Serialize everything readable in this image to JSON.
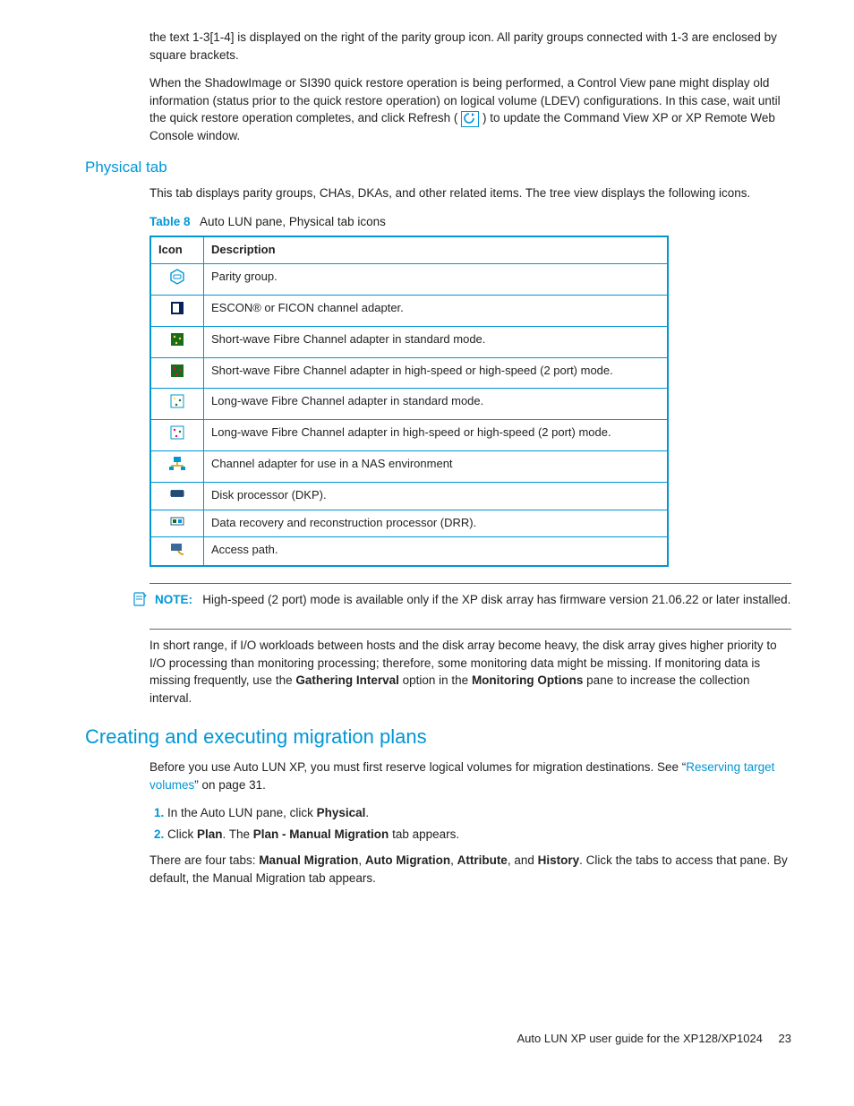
{
  "intro": {
    "p1": "the text 1-3[1-4] is displayed on the right of the parity group icon. All parity groups connected with 1-3 are enclosed by square brackets.",
    "p2a": "When the ShadowImage or SI390 quick restore operation is being performed, a Control View pane might display old information (status prior to the quick restore operation) on logical volume (LDEV) configurations. In this case, wait until the quick restore operation completes, and click Refresh (",
    "p2b": ") to update the Command View XP or XP Remote Web Console window."
  },
  "physical": {
    "heading": "Physical tab",
    "lead": "This tab displays parity groups, CHAs, DKAs, and other related items. The tree view displays the following icons.",
    "table_no": "Table 8",
    "table_title": "Auto LUN pane, Physical tab icons",
    "col_icon": "Icon",
    "col_desc": "Description",
    "rows": [
      "Parity group.",
      "ESCON® or FICON channel adapter.",
      "Short-wave Fibre Channel adapter in standard mode.",
      "Short-wave Fibre Channel adapter in high-speed or high-speed (2 port) mode.",
      "Long-wave Fibre Channel adapter in standard mode.",
      "Long-wave Fibre Channel adapter in high-speed or high-speed (2 port) mode.",
      "Channel adapter for use in a NAS environment",
      "Disk processor (DKP).",
      "Data recovery and reconstruction processor (DRR).",
      "Access path."
    ]
  },
  "note": {
    "label": "NOTE:",
    "text": "High-speed (2 port) mode is available only if the XP disk array has firmware version 21.06.22 or later installed."
  },
  "after_note": {
    "p1a": "In short range, if I/O workloads between hosts and the disk array become heavy, the disk array gives higher priority to I/O processing than monitoring processing; therefore, some monitoring data might be missing. If monitoring data is missing frequently, use the ",
    "b1": "Gathering Interval",
    "mid1": " option in the ",
    "b2": "Monitoring Options",
    "p1b": " pane to increase the collection interval."
  },
  "creating": {
    "heading": "Creating and executing migration plans",
    "lead_a": "Before you use Auto LUN XP, you must first reserve logical volumes for migration destinations. See “",
    "link": "Reserving target volumes",
    "lead_b": "” on page 31.",
    "step1a": "In the Auto LUN pane, click ",
    "step1b": "Physical",
    "step1c": ".",
    "step2a": "Click ",
    "step2b": "Plan",
    "step2c": ". The ",
    "step2d": "Plan - Manual Migration",
    "step2e": " tab appears.",
    "tail_a": "There are four tabs: ",
    "tail_b1": "Manual Migration",
    "tail_s1": ", ",
    "tail_b2": "Auto Migration",
    "tail_s2": ", ",
    "tail_b3": "Attribute",
    "tail_s3": ", and ",
    "tail_b4": "History",
    "tail_c": ". Click the tabs to access that pane. By default, the Manual Migration tab appears."
  },
  "footer": {
    "title": "Auto LUN XP user guide for the XP128/XP1024",
    "page": "23"
  }
}
